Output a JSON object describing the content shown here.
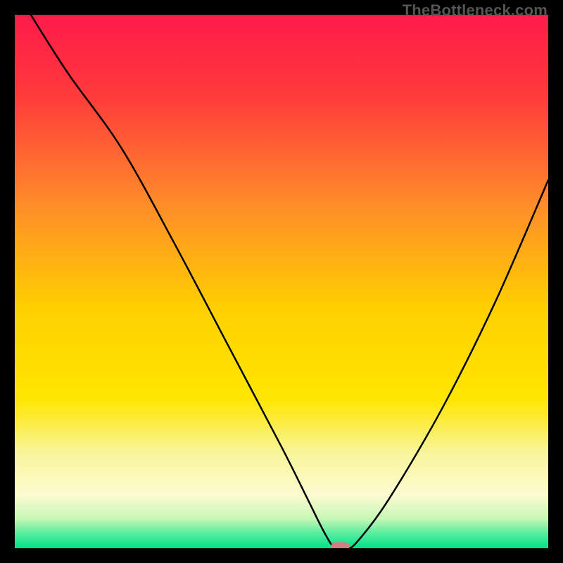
{
  "watermark": "TheBottleneck.com",
  "chart_data": {
    "type": "line",
    "title": "",
    "xlabel": "",
    "ylabel": "",
    "xlim": [
      0,
      100
    ],
    "ylim": [
      0,
      100
    ],
    "series": [
      {
        "name": "curve",
        "x": [
          3,
          10,
          20,
          30,
          40,
          50,
          55,
          58,
          60,
          62,
          64,
          70,
          80,
          90,
          100
        ],
        "y": [
          100,
          89,
          75,
          57,
          38,
          19,
          9,
          3,
          0,
          0,
          1,
          9,
          26,
          46,
          69
        ]
      }
    ],
    "marker": {
      "x": 61,
      "y": 0,
      "color": "#d87b83"
    },
    "gradient_stops": [
      {
        "offset": 0.0,
        "color": "#ff1a4b"
      },
      {
        "offset": 0.15,
        "color": "#ff3a3a"
      },
      {
        "offset": 0.35,
        "color": "#ff8a2a"
      },
      {
        "offset": 0.55,
        "color": "#ffd000"
      },
      {
        "offset": 0.72,
        "color": "#ffe600"
      },
      {
        "offset": 0.82,
        "color": "#f8f59a"
      },
      {
        "offset": 0.9,
        "color": "#fdfbd0"
      },
      {
        "offset": 0.945,
        "color": "#c6f7b6"
      },
      {
        "offset": 0.97,
        "color": "#5eeea0"
      },
      {
        "offset": 1.0,
        "color": "#00e18a"
      }
    ]
  }
}
